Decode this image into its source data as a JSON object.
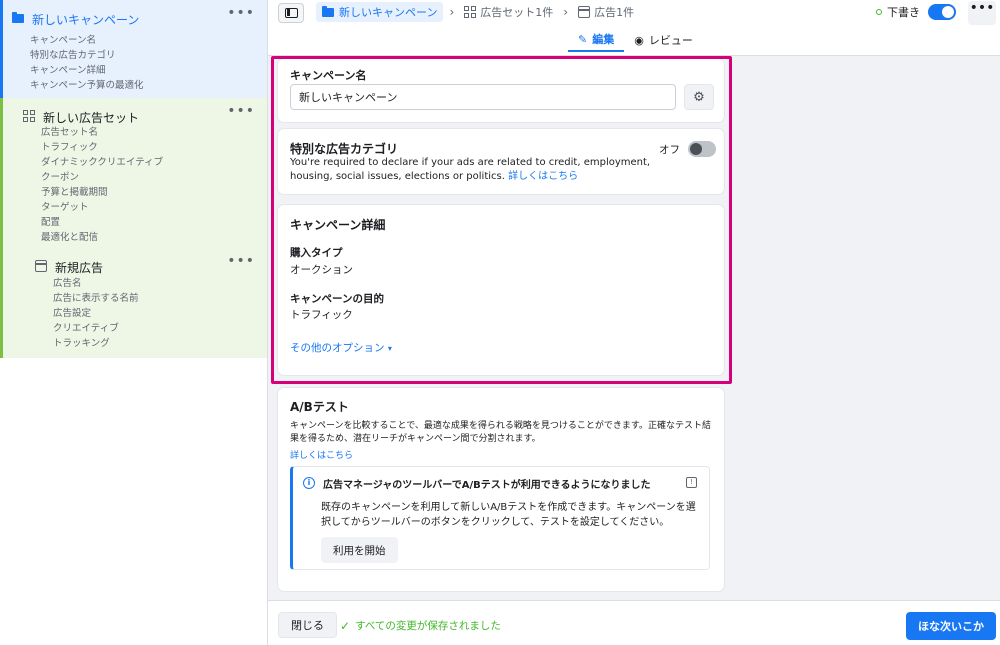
{
  "sidebar": {
    "campaign": {
      "title": "新しいキャンペーン",
      "items": [
        "キャンペーン名",
        "特別な広告カテゴリ",
        "キャンペーン詳細",
        "キャンペーン予算の最適化"
      ]
    },
    "adset": {
      "title": "新しい広告セット",
      "items": [
        "広告セット名",
        "トラフィック",
        "ダイナミッククリエイティブ",
        "クーポン",
        "予算と掲載期間",
        "ターゲット",
        "配置",
        "最適化と配信"
      ]
    },
    "ad": {
      "title": "新規広告",
      "items": [
        "広告名",
        "広告に表示する名前",
        "広告設定",
        "クリエイティブ",
        "トラッキング"
      ]
    },
    "more_label": "•••"
  },
  "topbar": {
    "breadcrumb": [
      "新しいキャンペーン",
      "広告セット1件",
      "広告1件"
    ],
    "draft_label": "下書き",
    "more_label": "•••",
    "tabs": [
      {
        "label": "編集",
        "icon": "pencil-icon"
      },
      {
        "label": "レビュー",
        "icon": "eye-icon"
      }
    ]
  },
  "main": {
    "campaign_name": {
      "label": "キャンペーン名",
      "value": "新しいキャンペーン"
    },
    "special_category": {
      "title": "特別な広告カテゴリ",
      "toggle_label": "オフ",
      "description": "You're required to declare if your ads are related to credit, employment, housing, social issues, elections or politics.",
      "link": "詳しくはこちら"
    },
    "details": {
      "title": "キャンペーン詳細",
      "buy_type_label": "購入タイプ",
      "buy_type_value": "オークション",
      "objective_label": "キャンペーンの目的",
      "objective_value": "トラフィック",
      "more_options": "その他のオプション"
    },
    "ab_test": {
      "title": "A/Bテスト",
      "description": "キャンペーンを比較することで、最適な成果を得られる戦略を見つけることができます。正確なテスト結果を得るため、潜在リーチがキャンペーン間で分割されます。",
      "link": "詳しくはこちら",
      "info_title": "広告マネージャのツールバーでA/Bテストが利用できるようになりました",
      "info_body": "既存のキャンペーンを利用して新しいA/Bテストを作成できます。キャンペーンを選択してからツールバーのボタンをクリックして、テストを設定してください。",
      "start_button": "利用を開始"
    }
  },
  "footer": {
    "close_label": "閉じる",
    "saved_text": "すべての変更が保存されました",
    "next_label": "ほな次いこか"
  },
  "colors": {
    "accent": "#1877f2",
    "highlight": "#d6007a",
    "success": "#42b72a"
  }
}
